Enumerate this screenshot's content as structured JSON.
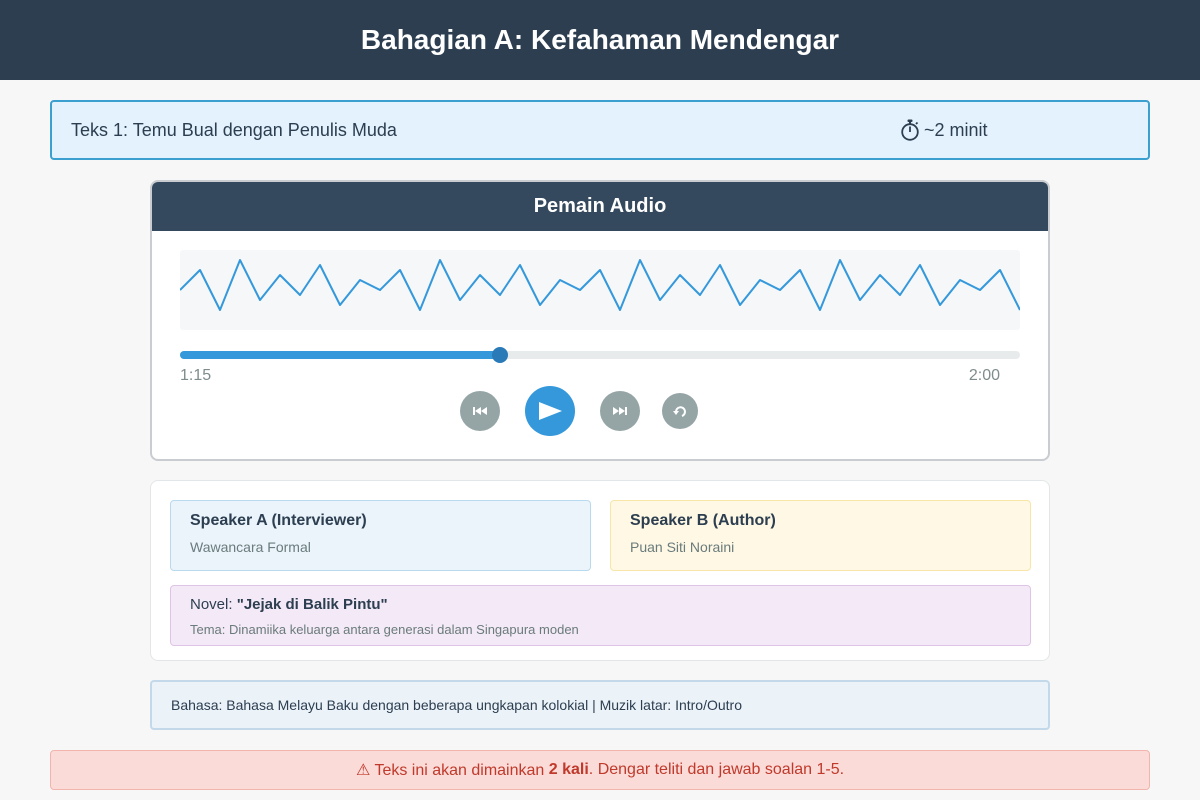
{
  "header": {
    "title": "Bahagian A: Kefahaman Mendengar"
  },
  "text_info": {
    "title": "Teks 1: Temu Bual dengan Penulis Muda",
    "duration_icon": "stopwatch-icon",
    "duration": "~2 minit"
  },
  "player": {
    "title": "Pemain Audio",
    "current_time": "1:15",
    "total_time": "2:00",
    "progress": 0.381,
    "controls": {
      "rewind_icon": "skip-back-icon",
      "play_icon": "play-icon",
      "forward_icon": "skip-forward-icon",
      "replay_icon": "replay-icon"
    },
    "colors": {
      "accent": "#3498db",
      "control": "#95a5a6",
      "header": "#34495e"
    }
  },
  "speakers": {
    "a": {
      "title": "Speaker A (Interviewer)",
      "subtitle": "Wawancara Formal"
    },
    "b": {
      "title": "Speaker B (Author)",
      "subtitle": "Puan Siti Noraini"
    },
    "novel": {
      "label": "Novel:",
      "name": "\"Jejak di Balik Pintu\"",
      "theme": "Tema: Dinamiika keluarga antara generasi dalam Singapura moden"
    }
  },
  "language_note": "Bahasa: Bahasa Melayu Baku dengan beberapa ungkapan kolokial | Muzik latar: Intro/Outro",
  "warning": {
    "icon": "warning-icon",
    "prefix": "⚠ Teks ini akan dimainkan",
    "emphasis": "2 kali",
    "suffix": ". Dengar teliti dan jawab soalan 1-5."
  }
}
